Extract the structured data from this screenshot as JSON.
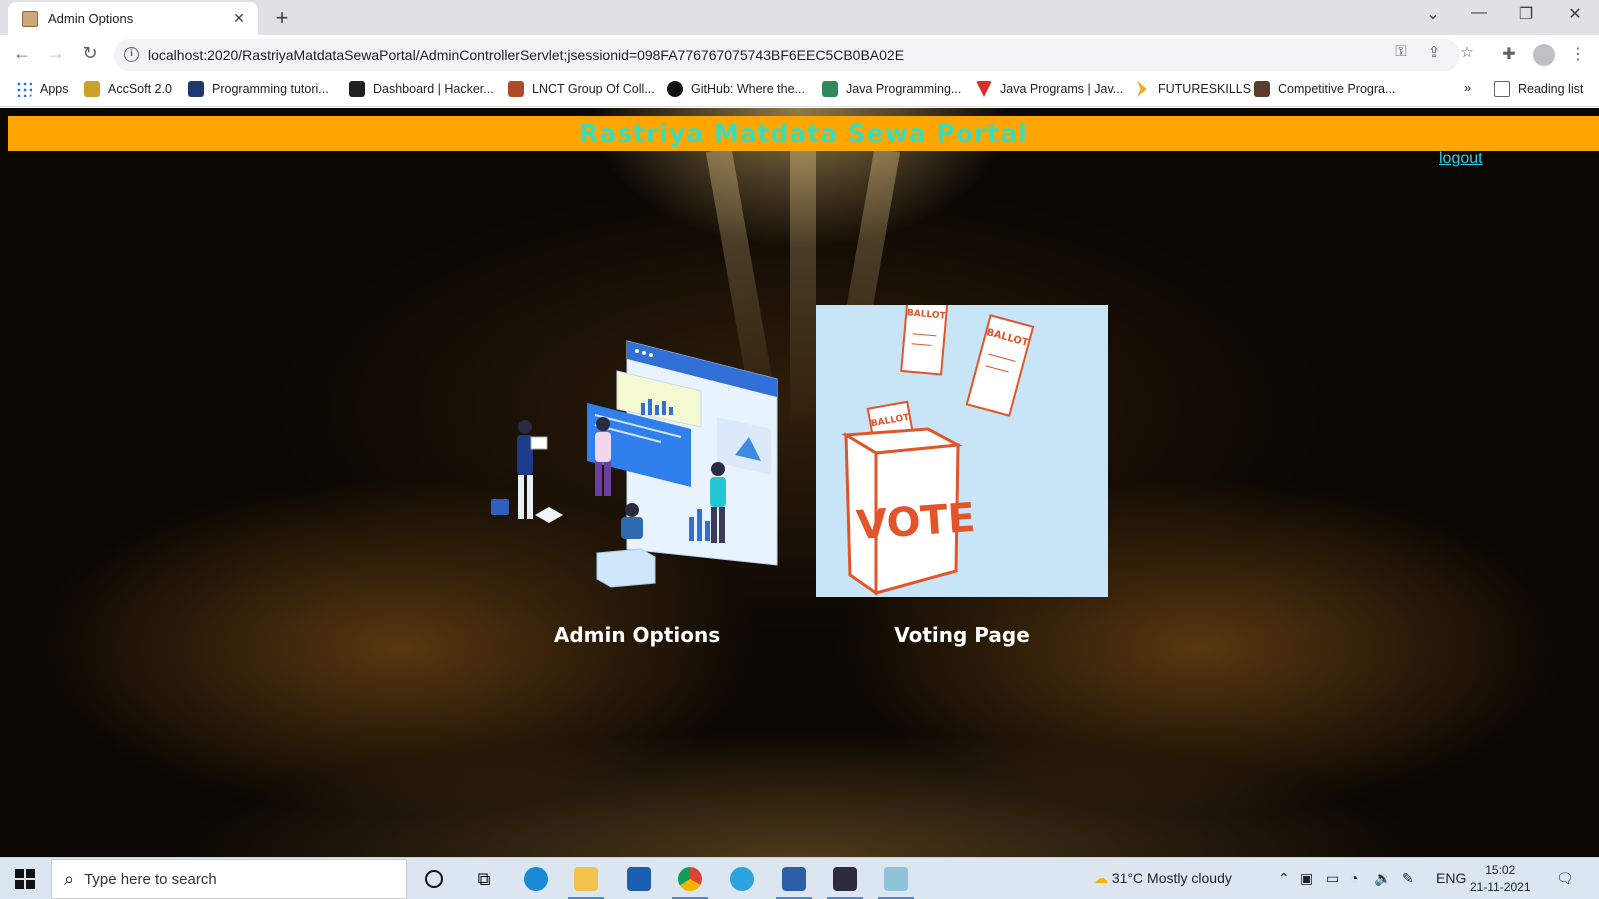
{
  "browser": {
    "tab_title": "Admin Options",
    "url": "localhost:2020/RastriyaMatdataSewaPortal/AdminControllerServlet;jsessionid=098FA776767075743BF6EEC5CB0BA02E"
  },
  "bookmarks": [
    {
      "label": "Apps",
      "color": "#1a73e8"
    },
    {
      "label": "AccSoft 2.0",
      "color": "#c9a227"
    },
    {
      "label": "Programming tutori...",
      "color": "#1b3b6f"
    },
    {
      "label": "Dashboard | Hacker...",
      "color": "#1f1f1f"
    },
    {
      "label": "LNCT Group Of Coll...",
      "color": "#b04a2a"
    },
    {
      "label": "GitHub: Where the...",
      "color": "#111111"
    },
    {
      "label": "Java Programming...",
      "color": "#2e8b57"
    },
    {
      "label": "Java Programs | Jav...",
      "color": "#d93025"
    },
    {
      "label": "FUTURESKILLS",
      "color": "#f5a623"
    },
    {
      "label": "Competitive Progra...",
      "color": "#5a3e2b"
    }
  ],
  "bookmarks_overflow": "»",
  "reading_list": "Reading list",
  "page": {
    "banner_title": "Rastriya Matdata Sewa Portal",
    "logout": "logout",
    "cards": [
      {
        "label": "Admin Options"
      },
      {
        "label": "Voting Page"
      }
    ],
    "vote_image": {
      "vote_text": "VOTE",
      "ballot_text": "BALLOT"
    }
  },
  "taskbar": {
    "search_placeholder": "Type here to search",
    "weather": "31°C  Mostly cloudy",
    "lang": "ENG",
    "time": "15:02",
    "date": "21-11-2021"
  }
}
